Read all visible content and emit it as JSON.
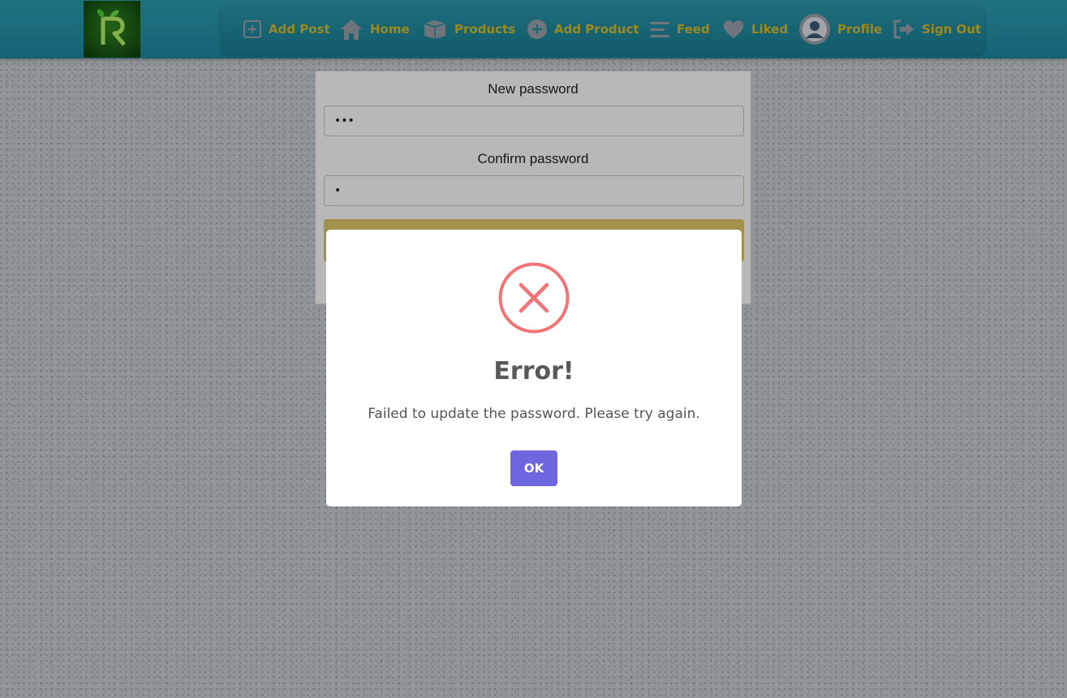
{
  "colors": {
    "header": "#1f8ea6",
    "nav_text": "#d9be2a",
    "error_icon": "#f27474",
    "ok_button": "#7066e0"
  },
  "header": {
    "logo_icon": "leaf-r-logo",
    "nav": [
      {
        "label": "Add Post",
        "icon": "plus-square-icon"
      },
      {
        "label": "Home",
        "icon": "home-icon"
      },
      {
        "label": "Products",
        "icon": "box-icon"
      },
      {
        "label": "Add Product",
        "icon": "plus-circle-icon"
      },
      {
        "label": "Feed",
        "icon": "menu-icon"
      },
      {
        "label": "Liked",
        "icon": "heart-icon"
      },
      {
        "label": "Profile",
        "icon": "user-avatar-icon"
      },
      {
        "label": "Sign Out",
        "icon": "sign-out-icon"
      }
    ]
  },
  "form": {
    "new_password_label": "New password",
    "new_password_value": "abc",
    "confirm_password_label": "Confirm password",
    "confirm_password_value": "a"
  },
  "modal": {
    "icon": "error-x-icon",
    "title": "Error!",
    "message": "Failed to update the password. Please try again.",
    "ok_label": "OK"
  }
}
